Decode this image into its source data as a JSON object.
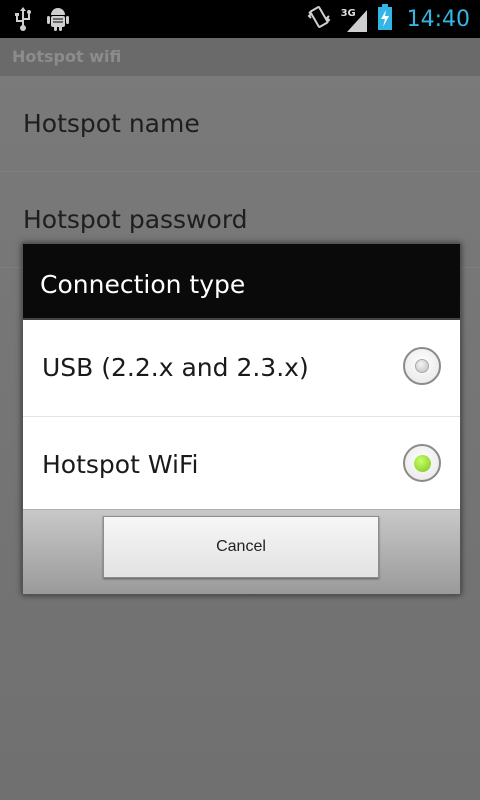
{
  "status_bar": {
    "time": "14:40",
    "network": "3G",
    "icons": [
      "usb-icon",
      "android-debug-icon",
      "vibrate-icon",
      "signal-icon",
      "battery-charging-icon"
    ],
    "accent_color": "#33b5e5"
  },
  "app": {
    "title": "Hotspot wifi",
    "preferences": [
      {
        "label": "Hotspot name"
      },
      {
        "label": "Hotspot password"
      }
    ]
  },
  "dialog": {
    "title": "Connection type",
    "options": [
      {
        "label": "USB (2.2.x and 2.3.x)",
        "selected": false
      },
      {
        "label": "Hotspot WiFi",
        "selected": true
      }
    ],
    "cancel_label": "Cancel",
    "selected_color": "#7ac41c"
  }
}
